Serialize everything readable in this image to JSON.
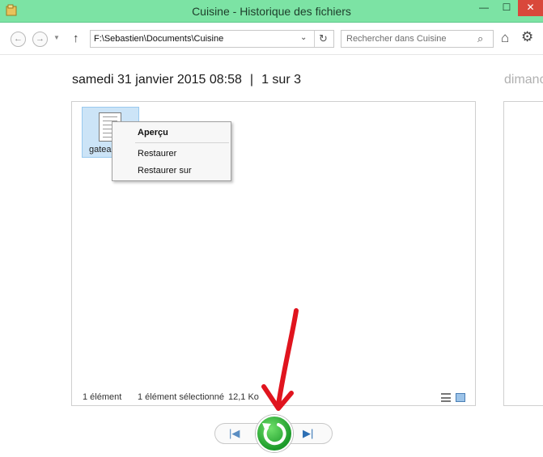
{
  "window": {
    "title": "Cuisine - Historique des fichiers",
    "minimize_glyph": "—",
    "maximize_glyph": "☐",
    "close_glyph": "✕"
  },
  "navbar": {
    "back_icon": "arrow-left-icon",
    "forward_icon": "arrow-right-icon",
    "up_glyph": "↑",
    "address": "F:\\Sebastien\\Documents\\Cuisine",
    "address_dropdown_glyph": "⌄",
    "refresh_glyph": "↻",
    "search_placeholder": "Rechercher dans Cuisine",
    "search_glyph": "⌕",
    "home_glyph": "⌂",
    "settings_glyph": "⚙"
  },
  "header": {
    "date": "samedi 31 janvier 2015 08:58",
    "separator": "|",
    "position": "1 sur 3",
    "next_date_partial": "dimanc"
  },
  "files": [
    {
      "name": "gatea"
    }
  ],
  "context_menu": {
    "items": [
      "Aperçu",
      "Restaurer",
      "Restaurer sur"
    ]
  },
  "status": {
    "count": "1 élément",
    "selected": "1 élément sélectionné",
    "size": "12,1 Ko"
  },
  "controls": {
    "previous_glyph": "|◀",
    "next_glyph": "▶|",
    "restore_icon": "restore-icon"
  },
  "colors": {
    "titlebar": "#7ce3a4",
    "restore_button": "#1c9a2a",
    "annotation_arrow": "#e0141e",
    "selection": "#cce4f7"
  }
}
